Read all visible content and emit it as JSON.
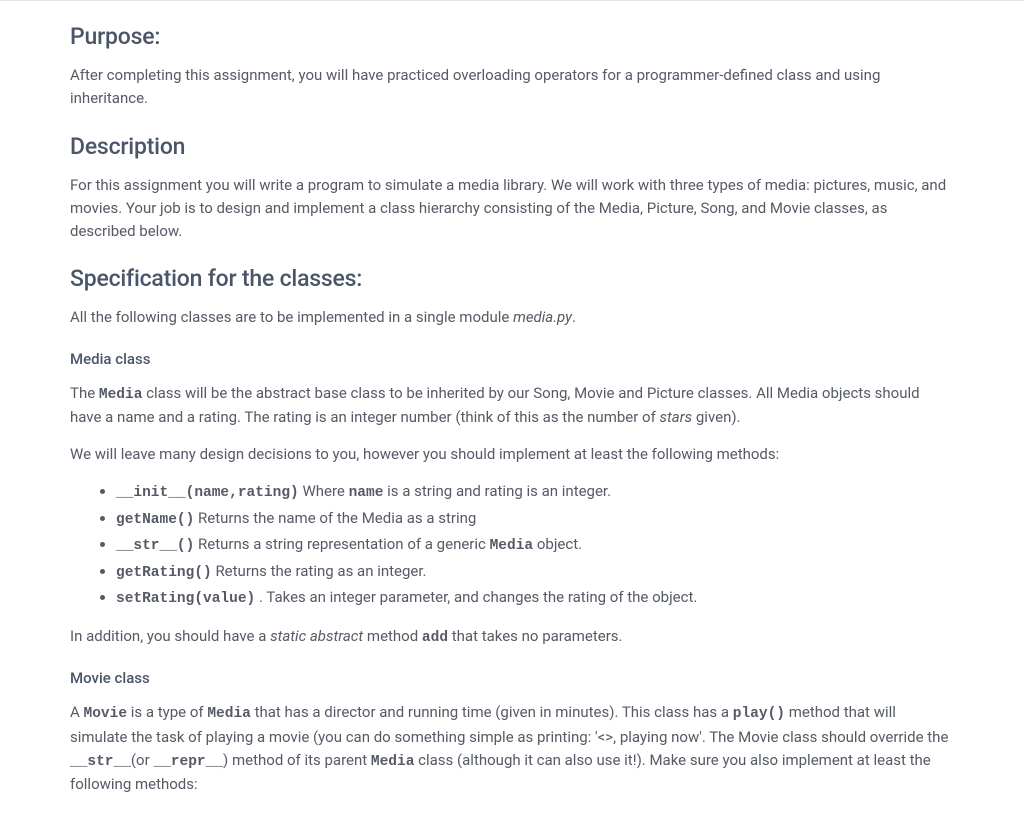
{
  "headings": {
    "purpose": "Purpose:",
    "description": "Description",
    "specification": "Specification for the classes:",
    "mediaClass": "Media class",
    "movieClass": "Movie class"
  },
  "purpose": {
    "p1": "After completing this assignment, you will have practiced overloading operators for a programmer-defined class and using inheritance."
  },
  "description": {
    "p1": "For this assignment you will write a program to simulate a media library. We will work with three types of media: pictures, music, and movies. Your job is to design and implement a class hierarchy consisting of the Media, Picture, Song, and Movie classes, as described below."
  },
  "specification": {
    "p1_a": "All the following classes are to be implemented in a single module ",
    "p1_em": "media.py",
    "p1_b": "."
  },
  "mediaClass": {
    "p1_a": "The ",
    "p1_code": "Media",
    "p1_b": " class will be the abstract base class to be inherited by our Song, Movie and Picture classes. All Media objects should have a name and a rating. The rating is an integer number (think of this as the number of ",
    "p1_em": "stars",
    "p1_c": " given).",
    "p2": "We will leave many design decisions to you, however you should implement at least the following methods:",
    "methods": [
      {
        "code1": "__init__(name,rating)",
        "text1": " Where ",
        "code2": "name",
        "text2": " is a string and rating is an integer."
      },
      {
        "code1": "getName()",
        "text1": " Returns the name of the Media as a string",
        "code2": "",
        "text2": ""
      },
      {
        "code1": "__str__()",
        "text1": " Returns a string representation of a generic ",
        "code2": "Media",
        "text2": " object."
      },
      {
        "code1": "getRating()",
        "text1": " Returns the rating as an integer.",
        "code2": "",
        "text2": ""
      },
      {
        "code1": "setRating(value)",
        "text1": " . Takes an integer parameter, and changes the rating of the object.",
        "code2": "",
        "text2": ""
      }
    ],
    "p3_a": "In addition, you should have a ",
    "p3_em": "static abstract",
    "p3_b": " method ",
    "p3_code": "add",
    "p3_c": " that takes no parameters."
  },
  "movieClass": {
    "p1_a": "A ",
    "p1_code1": "Movie",
    "p1_b": " is a type of ",
    "p1_code2": "Media",
    "p1_c": " that has a director and running time (given in minutes). This class has a ",
    "p1_code3": "play()",
    "p1_d": " method that will simulate the task of playing a movie (you can do something simple as printing: '<>, playing now'. The Movie class should override the ",
    "p1_code4": "__str__",
    "p1_e": "(or ",
    "p1_code5": "__repr__",
    "p1_f": ") method of its parent ",
    "p1_code6": "Media",
    "p1_g": " class (although it can also use it!). Make sure you also implement at least the following methods:"
  }
}
